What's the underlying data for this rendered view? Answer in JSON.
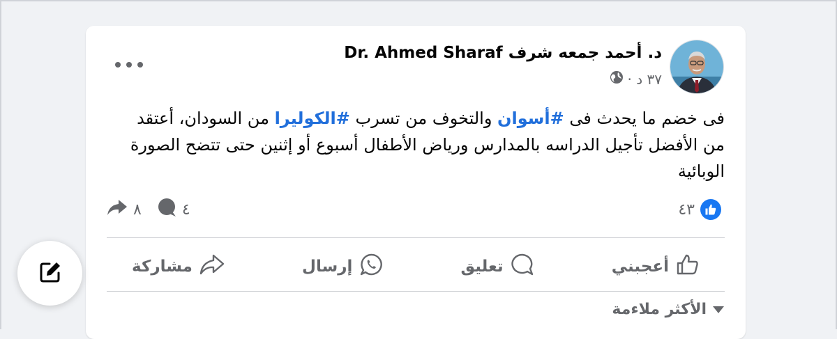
{
  "post": {
    "author": "د. أحمد جمعه شرف Dr. Ahmed Sharaf",
    "time": "٣٧ د ·",
    "text": {
      "part1": "فى خضم ما يحدث فى ",
      "hashtag1": "#أسوان",
      "part2": " والتخوف من تسرب ",
      "hashtag2": "#الكوليرا",
      "part3": " من السودان، أعتقد من الأفضل تأجيل الدراسه بالمدارس ورياض الأطفال أسبوع أو إثنين حتى تتضح الصورة الوبائية"
    },
    "reactions_count": "٤٣",
    "comments_count": "٤",
    "shares_count": "٨"
  },
  "actions": {
    "like": "أعجبني",
    "comment": "تعليق",
    "send": "إرسال",
    "share": "مشاركة"
  },
  "comments_sort": "الأكثر ملاءمة",
  "icons": {
    "privacy": "globe-icon",
    "more": "more-options-icon",
    "like": "thumbs-up-icon",
    "comment": "comment-bubble-icon",
    "send": "whatsapp-icon",
    "share": "share-arrow-icon",
    "sort": "caret-down-icon",
    "compose": "compose-icon"
  },
  "colors": {
    "accent": "#1877f2",
    "hashtag": "#216fdb",
    "secondary_text": "#65676b"
  }
}
